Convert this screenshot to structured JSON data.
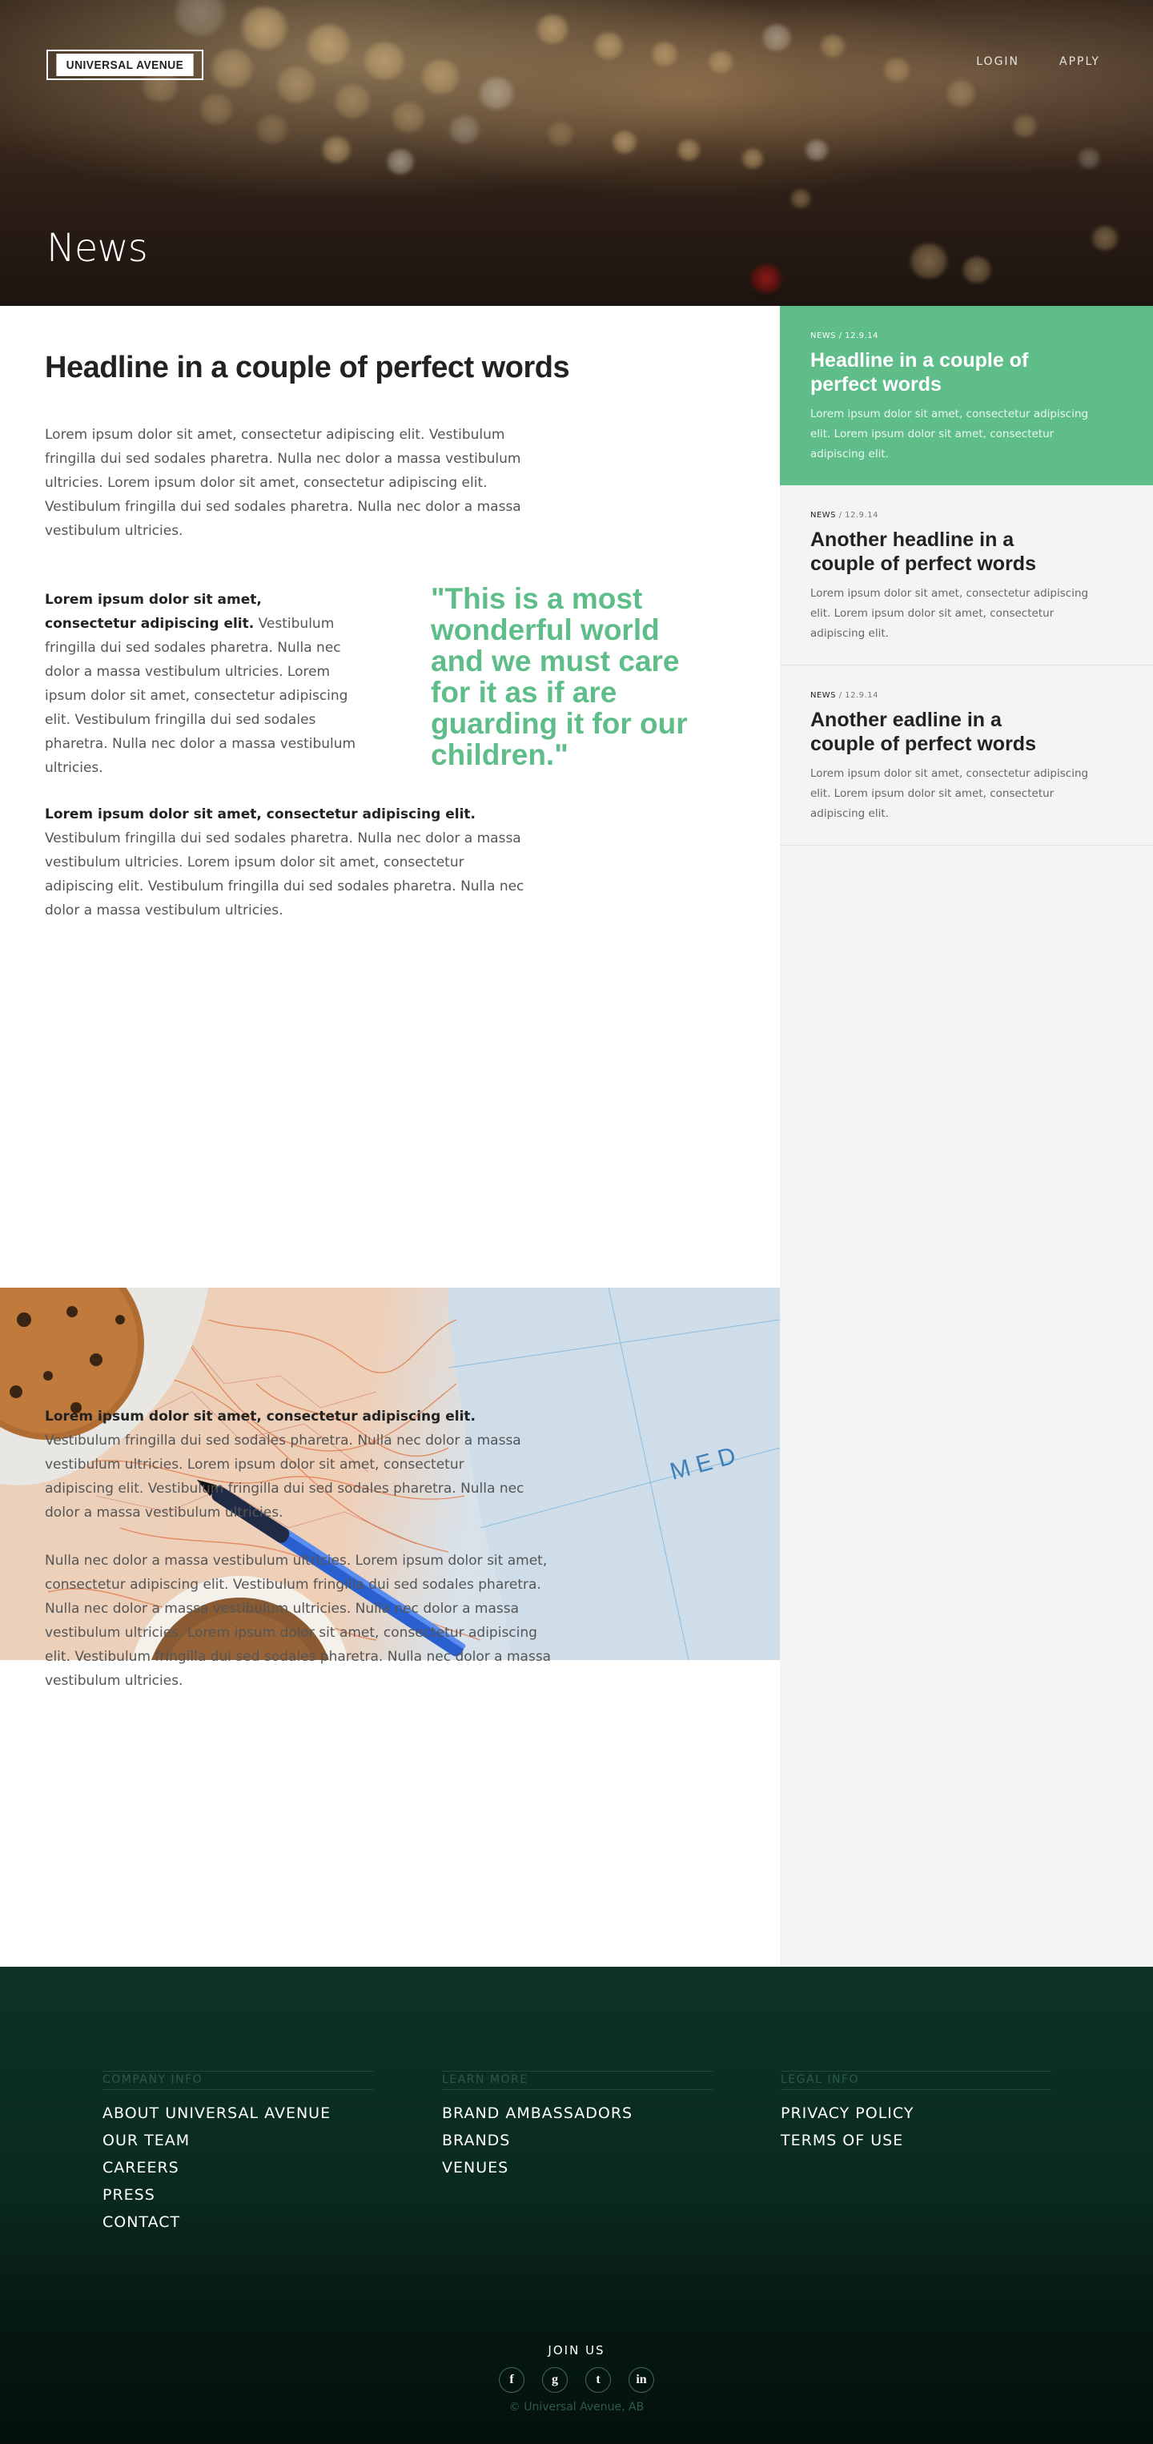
{
  "brand": {
    "logo_text": "UNIVERSAL AVENUE"
  },
  "nav": {
    "login": "LOGIN",
    "apply": "APPLY"
  },
  "hero": {
    "title": "News"
  },
  "article": {
    "headline": "Headline in a couple of perfect words",
    "para1": "Lorem ipsum dolor sit amet, consectetur adipiscing elit. Vestibulum fringilla dui sed sodales pharetra. Nulla nec dolor a massa vestibulum ultricies. Lorem ipsum dolor sit amet, consectetur adipiscing elit. Vestibulum fringilla dui sed sodales pharetra. Nulla nec dolor a massa vestibulum ultricies.",
    "para2_bold": "Lorem ipsum dolor sit amet, consectetur adipiscing elit.",
    "para2_rest": " Vestibulum fringilla dui sed sodales pharetra. Nulla nec dolor a massa vestibulum ultricies. Lorem ipsum dolor sit amet, consectetur adipiscing elit. Vestibulum fringilla dui sed sodales pharetra. Nulla nec dolor a massa vestibulum ultricies.",
    "quote": "\"This is a most wonderful world and we must care for it as if are guarding it for our children.\"",
    "para3_bold": "Lorem ipsum dolor sit amet, consectetur adipiscing elit.",
    "para3_rest": " Vestibulum fringilla dui sed sodales pharetra. Nulla nec dolor a massa vestibulum ultricies. Lorem ipsum dolor sit amet, consectetur adipiscing elit. Vestibulum fringilla dui sed sodales pharetra. Nulla nec dolor a massa vestibulum ultricies.",
    "para4_bold": "Lorem ipsum dolor sit amet, consectetur adipiscing elit.",
    "para4_rest": " Vestibulum fringilla dui sed sodales pharetra. Nulla nec dolor a massa vestibulum ultricies. Lorem ipsum dolor sit amet, consectetur adipiscing elit. Vestibulum fringilla dui sed sodales pharetra. Nulla nec dolor a massa vestibulum ultricies.",
    "para5": "Nulla nec dolor a massa vestibulum ultricies. Lorem ipsum dolor sit amet, consectetur adipiscing elit. Vestibulum fringilla dui sed sodales pharetra. Nulla nec dolor a massa vestibulum ultricies. Nulla nec dolor a massa vestibulum ultricies. Lorem ipsum dolor sit amet, consectetur adipiscing elit. Vestibulum fringilla dui sed sodales pharetra. Nulla nec dolor a massa vestibulum ultricies."
  },
  "sidebar": {
    "cards": [
      {
        "category": "NEWS",
        "date": " / 12.9.14",
        "title": "Headline in a couple of perfect words",
        "excerpt": "Lorem ipsum dolor sit amet, consectetur adipiscing elit. Lorem ipsum dolor sit amet, consectetur adipiscing elit."
      },
      {
        "category": "NEWS",
        "date": " / 12.9.14",
        "title": "Another headline in a couple of perfect words",
        "excerpt": "Lorem ipsum dolor sit amet, consectetur adipiscing elit. Lorem ipsum dolor sit amet, consectetur adipiscing elit."
      },
      {
        "category": "NEWS",
        "date": " / 12.9.14",
        "title": "Another eadline in a couple of perfect words",
        "excerpt": "Lorem ipsum dolor sit amet, consectetur adipiscing elit. Lorem ipsum dolor sit amet, consectetur adipiscing elit."
      }
    ]
  },
  "footer": {
    "columns": [
      {
        "heading": "COMPANY INFO",
        "links": [
          "ABOUT UNIVERSAL AVENUE",
          "OUR TEAM",
          "CAREERS",
          "PRESS",
          "CONTACT"
        ]
      },
      {
        "heading": "LEARN MORE",
        "links": [
          "BRAND AMBASSADORS",
          "BRANDS",
          "VENUES"
        ]
      },
      {
        "heading": "LEGAL INFO",
        "links": [
          "PRIVACY POLICY",
          "TERMS OF USE"
        ]
      }
    ],
    "join_label": "JOIN US",
    "socials": [
      {
        "icon": "facebook-icon",
        "glyph": "f"
      },
      {
        "icon": "google-icon",
        "glyph": "g"
      },
      {
        "icon": "twitter-icon",
        "glyph": "t"
      },
      {
        "icon": "linkedin-icon",
        "glyph": "in"
      }
    ],
    "copyright": "© Universal Avenue, AB"
  },
  "colors": {
    "accent": "#5fbd8a",
    "footer_dark": "#0c3326",
    "sidebar_bg": "#f4f4f4"
  }
}
